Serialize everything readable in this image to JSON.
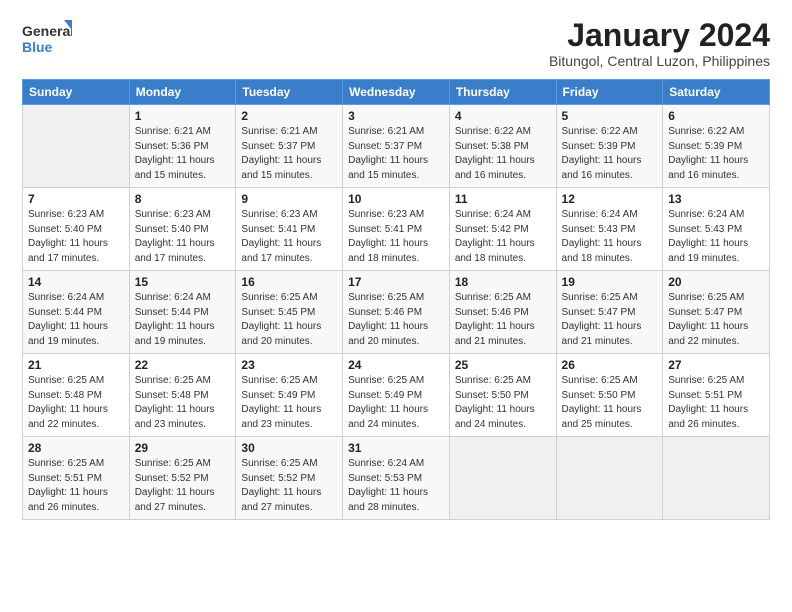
{
  "logo": {
    "line1": "General",
    "line2": "Blue"
  },
  "title": "January 2024",
  "subtitle": "Bitungol, Central Luzon, Philippines",
  "days_header": [
    "Sunday",
    "Monday",
    "Tuesday",
    "Wednesday",
    "Thursday",
    "Friday",
    "Saturday"
  ],
  "weeks": [
    [
      {
        "day": "",
        "info": ""
      },
      {
        "day": "1",
        "info": "Sunrise: 6:21 AM\nSunset: 5:36 PM\nDaylight: 11 hours\nand 15 minutes."
      },
      {
        "day": "2",
        "info": "Sunrise: 6:21 AM\nSunset: 5:37 PM\nDaylight: 11 hours\nand 15 minutes."
      },
      {
        "day": "3",
        "info": "Sunrise: 6:21 AM\nSunset: 5:37 PM\nDaylight: 11 hours\nand 15 minutes."
      },
      {
        "day": "4",
        "info": "Sunrise: 6:22 AM\nSunset: 5:38 PM\nDaylight: 11 hours\nand 16 minutes."
      },
      {
        "day": "5",
        "info": "Sunrise: 6:22 AM\nSunset: 5:39 PM\nDaylight: 11 hours\nand 16 minutes."
      },
      {
        "day": "6",
        "info": "Sunrise: 6:22 AM\nSunset: 5:39 PM\nDaylight: 11 hours\nand 16 minutes."
      }
    ],
    [
      {
        "day": "7",
        "info": "Sunrise: 6:23 AM\nSunset: 5:40 PM\nDaylight: 11 hours\nand 17 minutes."
      },
      {
        "day": "8",
        "info": "Sunrise: 6:23 AM\nSunset: 5:40 PM\nDaylight: 11 hours\nand 17 minutes."
      },
      {
        "day": "9",
        "info": "Sunrise: 6:23 AM\nSunset: 5:41 PM\nDaylight: 11 hours\nand 17 minutes."
      },
      {
        "day": "10",
        "info": "Sunrise: 6:23 AM\nSunset: 5:41 PM\nDaylight: 11 hours\nand 18 minutes."
      },
      {
        "day": "11",
        "info": "Sunrise: 6:24 AM\nSunset: 5:42 PM\nDaylight: 11 hours\nand 18 minutes."
      },
      {
        "day": "12",
        "info": "Sunrise: 6:24 AM\nSunset: 5:43 PM\nDaylight: 11 hours\nand 18 minutes."
      },
      {
        "day": "13",
        "info": "Sunrise: 6:24 AM\nSunset: 5:43 PM\nDaylight: 11 hours\nand 19 minutes."
      }
    ],
    [
      {
        "day": "14",
        "info": "Sunrise: 6:24 AM\nSunset: 5:44 PM\nDaylight: 11 hours\nand 19 minutes."
      },
      {
        "day": "15",
        "info": "Sunrise: 6:24 AM\nSunset: 5:44 PM\nDaylight: 11 hours\nand 19 minutes."
      },
      {
        "day": "16",
        "info": "Sunrise: 6:25 AM\nSunset: 5:45 PM\nDaylight: 11 hours\nand 20 minutes."
      },
      {
        "day": "17",
        "info": "Sunrise: 6:25 AM\nSunset: 5:46 PM\nDaylight: 11 hours\nand 20 minutes."
      },
      {
        "day": "18",
        "info": "Sunrise: 6:25 AM\nSunset: 5:46 PM\nDaylight: 11 hours\nand 21 minutes."
      },
      {
        "day": "19",
        "info": "Sunrise: 6:25 AM\nSunset: 5:47 PM\nDaylight: 11 hours\nand 21 minutes."
      },
      {
        "day": "20",
        "info": "Sunrise: 6:25 AM\nSunset: 5:47 PM\nDaylight: 11 hours\nand 22 minutes."
      }
    ],
    [
      {
        "day": "21",
        "info": "Sunrise: 6:25 AM\nSunset: 5:48 PM\nDaylight: 11 hours\nand 22 minutes."
      },
      {
        "day": "22",
        "info": "Sunrise: 6:25 AM\nSunset: 5:48 PM\nDaylight: 11 hours\nand 23 minutes."
      },
      {
        "day": "23",
        "info": "Sunrise: 6:25 AM\nSunset: 5:49 PM\nDaylight: 11 hours\nand 23 minutes."
      },
      {
        "day": "24",
        "info": "Sunrise: 6:25 AM\nSunset: 5:49 PM\nDaylight: 11 hours\nand 24 minutes."
      },
      {
        "day": "25",
        "info": "Sunrise: 6:25 AM\nSunset: 5:50 PM\nDaylight: 11 hours\nand 24 minutes."
      },
      {
        "day": "26",
        "info": "Sunrise: 6:25 AM\nSunset: 5:50 PM\nDaylight: 11 hours\nand 25 minutes."
      },
      {
        "day": "27",
        "info": "Sunrise: 6:25 AM\nSunset: 5:51 PM\nDaylight: 11 hours\nand 26 minutes."
      }
    ],
    [
      {
        "day": "28",
        "info": "Sunrise: 6:25 AM\nSunset: 5:51 PM\nDaylight: 11 hours\nand 26 minutes."
      },
      {
        "day": "29",
        "info": "Sunrise: 6:25 AM\nSunset: 5:52 PM\nDaylight: 11 hours\nand 27 minutes."
      },
      {
        "day": "30",
        "info": "Sunrise: 6:25 AM\nSunset: 5:52 PM\nDaylight: 11 hours\nand 27 minutes."
      },
      {
        "day": "31",
        "info": "Sunrise: 6:24 AM\nSunset: 5:53 PM\nDaylight: 11 hours\nand 28 minutes."
      },
      {
        "day": "",
        "info": ""
      },
      {
        "day": "",
        "info": ""
      },
      {
        "day": "",
        "info": ""
      }
    ]
  ]
}
